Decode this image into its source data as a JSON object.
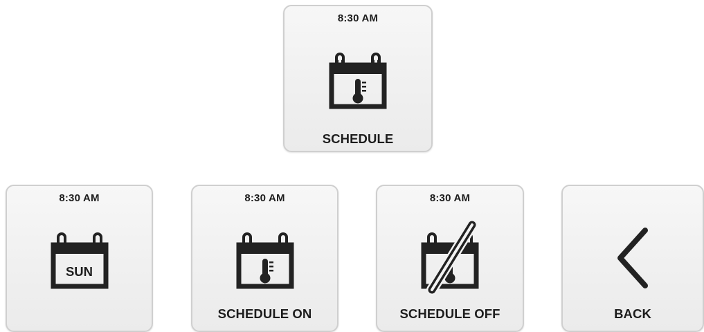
{
  "tiles": {
    "schedule": {
      "time": "8:30 AM",
      "label": "SCHEDULE"
    },
    "day": {
      "time": "8:30 AM",
      "day": "SUN"
    },
    "schedule_on": {
      "time": "8:30 AM",
      "label": "SCHEDULE ON"
    },
    "schedule_off": {
      "time": "8:30 AM",
      "label": "SCHEDULE OFF"
    },
    "back": {
      "label": "BACK"
    }
  },
  "icons": {
    "schedule": "calendar-thermometer-icon",
    "day": "calendar-day-icon",
    "schedule_on": "calendar-thermometer-icon",
    "schedule_off": "calendar-disabled-icon",
    "back": "chevron-left-icon"
  },
  "colors": {
    "icon": "#222222",
    "tile_border": "#cfcfcf",
    "tile_bg": "#f2f2f2"
  }
}
